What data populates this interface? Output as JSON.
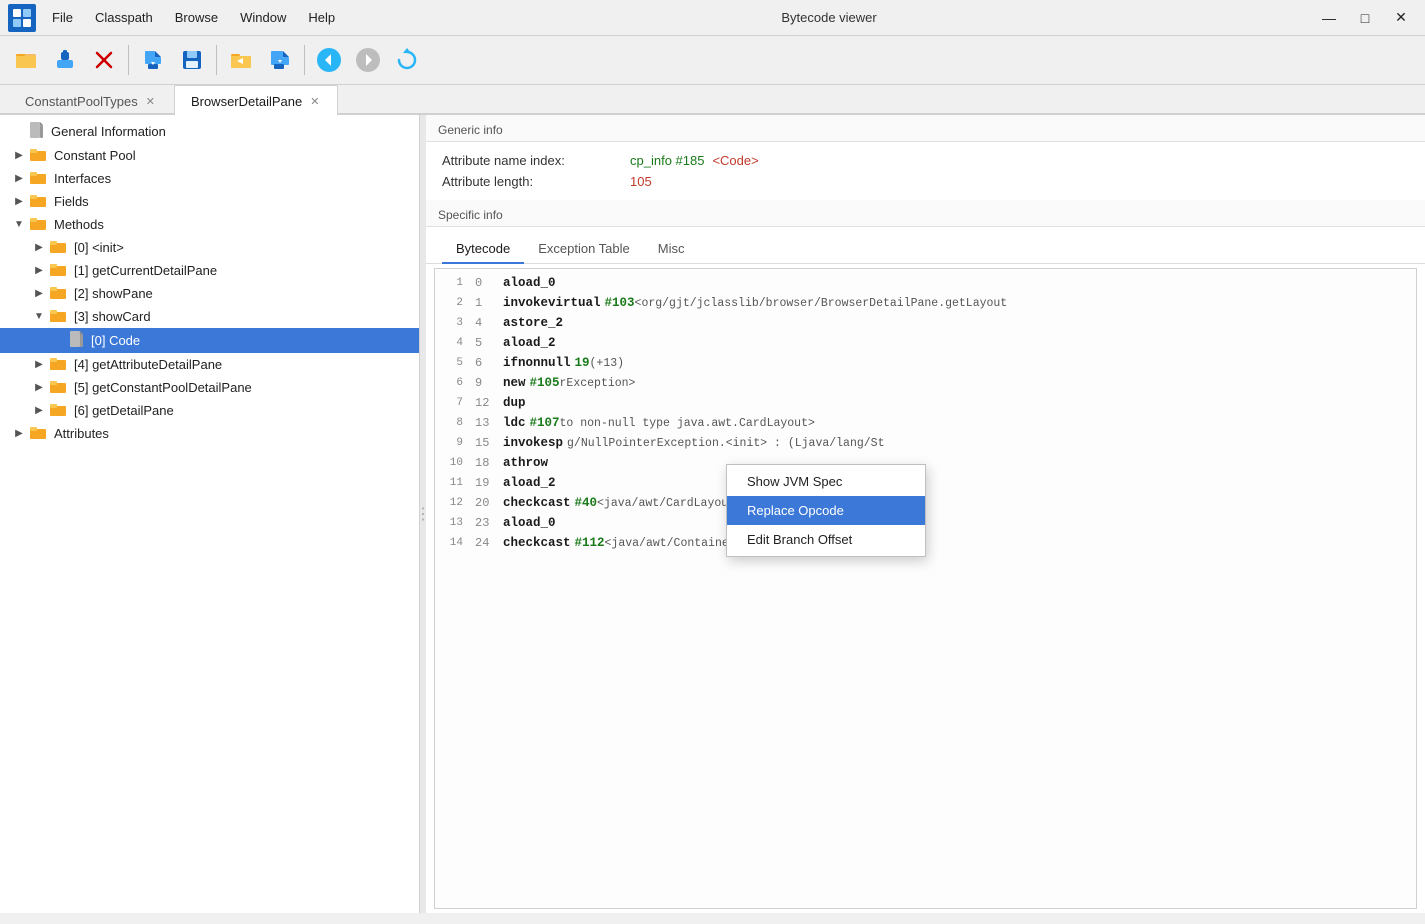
{
  "titlebar": {
    "title": "Bytecode viewer",
    "menu": [
      "File",
      "Classpath",
      "Browse",
      "Window",
      "Help"
    ],
    "controls": [
      "—",
      "□",
      "✕"
    ]
  },
  "toolbar": {
    "buttons": [
      {
        "name": "open-folder",
        "icon": "📂"
      },
      {
        "name": "plugin",
        "icon": "🔌"
      },
      {
        "name": "close-x",
        "icon": "✕"
      },
      {
        "name": "import",
        "icon": "📥"
      },
      {
        "name": "save",
        "icon": "💾"
      },
      {
        "name": "open-file",
        "icon": "📁"
      },
      {
        "name": "export",
        "icon": "📤"
      },
      {
        "name": "back",
        "icon": "◀"
      },
      {
        "name": "forward",
        "icon": "▶"
      },
      {
        "name": "refresh",
        "icon": "🔄"
      }
    ]
  },
  "tabs": [
    {
      "label": "ConstantPoolTypes",
      "active": false
    },
    {
      "label": "BrowserDetailPane",
      "active": true
    }
  ],
  "sidebar": {
    "items": [
      {
        "id": "general-info",
        "label": "General Information",
        "level": 0,
        "type": "file",
        "expanded": false,
        "selected": false
      },
      {
        "id": "constant-pool",
        "label": "Constant Pool",
        "level": 0,
        "type": "folder",
        "expanded": false,
        "selected": false
      },
      {
        "id": "interfaces",
        "label": "Interfaces",
        "level": 0,
        "type": "folder",
        "expanded": false,
        "selected": false
      },
      {
        "id": "fields",
        "label": "Fields",
        "level": 0,
        "type": "folder",
        "expanded": false,
        "selected": false
      },
      {
        "id": "methods",
        "label": "Methods",
        "level": 0,
        "type": "folder",
        "expanded": true,
        "selected": false
      },
      {
        "id": "init",
        "label": "[0] <init>",
        "level": 1,
        "type": "folder",
        "expanded": false,
        "selected": false
      },
      {
        "id": "getCurrentDetailPane",
        "label": "[1] getCurrentDetailPane",
        "level": 1,
        "type": "folder",
        "expanded": false,
        "selected": false
      },
      {
        "id": "showPane",
        "label": "[2] showPane",
        "level": 1,
        "type": "folder",
        "expanded": false,
        "selected": false
      },
      {
        "id": "showCard",
        "label": "[3] showCard",
        "level": 1,
        "type": "folder",
        "expanded": true,
        "selected": false
      },
      {
        "id": "code",
        "label": "[0] Code",
        "level": 2,
        "type": "file",
        "expanded": false,
        "selected": true
      },
      {
        "id": "getAttributeDetailPane",
        "label": "[4] getAttributeDetailPane",
        "level": 1,
        "type": "folder",
        "expanded": false,
        "selected": false
      },
      {
        "id": "getConstantPoolDetailPane",
        "label": "[5] getConstantPoolDetailPane",
        "level": 1,
        "type": "folder",
        "expanded": false,
        "selected": false
      },
      {
        "id": "getDetailPane",
        "label": "[6] getDetailPane",
        "level": 1,
        "type": "folder",
        "expanded": false,
        "selected": false
      },
      {
        "id": "attributes",
        "label": "Attributes",
        "level": 0,
        "type": "folder",
        "expanded": false,
        "selected": false
      }
    ]
  },
  "content": {
    "generic_info_label": "Generic info",
    "attr_name_index_label": "Attribute name index:",
    "attr_name_index_value_green": "cp_info #185",
    "attr_name_index_value_red": "<Code>",
    "attr_length_label": "Attribute length:",
    "attr_length_value": "105",
    "specific_info_label": "Specific info",
    "code_tabs": [
      "Bytecode",
      "Exception Table",
      "Misc"
    ],
    "active_code_tab": "Bytecode",
    "bytecode_lines": [
      {
        "lineNum": "1",
        "pc": "0",
        "opcode": "aload_0",
        "refs": [],
        "comment": ""
      },
      {
        "lineNum": "2",
        "pc": "1",
        "opcode": "invokevirtual",
        "refs": [
          "#103"
        ],
        "comment": "<org/gjt/jclasslib/browser/BrowserDetailPane.getLayout"
      },
      {
        "lineNum": "3",
        "pc": "4",
        "opcode": "astore_2",
        "refs": [],
        "comment": ""
      },
      {
        "lineNum": "4",
        "pc": "5",
        "opcode": "aload_2",
        "refs": [],
        "comment": ""
      },
      {
        "lineNum": "5",
        "pc": "6",
        "opcode": "ifnonnull",
        "refs": [
          "19"
        ],
        "comment": "(+13)"
      },
      {
        "lineNum": "6",
        "pc": "9",
        "opcode": "new",
        "refs": [
          "#105"
        ],
        "comment": "rException>"
      },
      {
        "lineNum": "7",
        "pc": "12",
        "opcode": "dup",
        "refs": [],
        "comment": ""
      },
      {
        "lineNum": "8",
        "pc": "13",
        "opcode": "ldc",
        "refs": [
          "#107"
        ],
        "comment": "to non-null type java.awt.CardLayout>"
      },
      {
        "lineNum": "9",
        "pc": "15",
        "opcode": "invokesp",
        "refs": [],
        "comment": "g/NullPointerException.<init> : (Ljava/lang/St"
      },
      {
        "lineNum": "10",
        "pc": "18",
        "opcode": "athrow",
        "refs": [],
        "comment": ""
      },
      {
        "lineNum": "11",
        "pc": "19",
        "opcode": "aload_2",
        "refs": [],
        "comment": ""
      },
      {
        "lineNum": "12",
        "pc": "20",
        "opcode": "checkcast",
        "refs": [
          "#40"
        ],
        "comment": "<java/awt/CardLayout>"
      },
      {
        "lineNum": "13",
        "pc": "23",
        "opcode": "aload_0",
        "refs": [],
        "comment": ""
      },
      {
        "lineNum": "14",
        "pc": "24",
        "opcode": "checkcast",
        "refs": [
          "#112"
        ],
        "comment": "<java/awt/Container>"
      }
    ],
    "context_menu": {
      "items": [
        {
          "label": "Show JVM Spec",
          "highlighted": false
        },
        {
          "label": "Replace Opcode",
          "highlighted": true
        },
        {
          "label": "Edit Branch Offset",
          "highlighted": false
        }
      ]
    }
  }
}
